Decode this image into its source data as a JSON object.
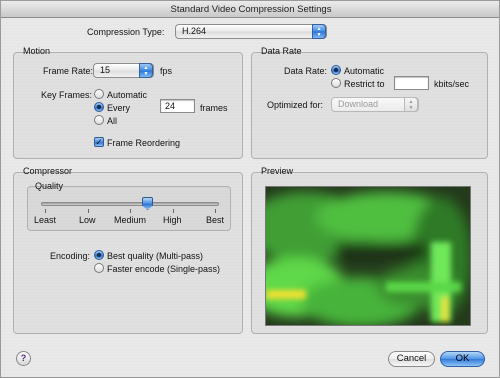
{
  "window": {
    "title": "Standard Video Compression Settings"
  },
  "compression_type": {
    "label": "Compression Type:",
    "value": "H.264"
  },
  "motion": {
    "title": "Motion",
    "frame_rate_label": "Frame Rate:",
    "frame_rate_value": "15",
    "frame_rate_unit": "fps",
    "key_frames_label": "Key Frames:",
    "key_frames_options": [
      "Automatic",
      "Every",
      "All"
    ],
    "key_frames_selected": "Every",
    "key_frames_every_value": "24",
    "key_frames_every_unit": "frames",
    "frame_reordering_label": "Frame Reordering",
    "frame_reordering_checked": true
  },
  "data_rate": {
    "title": "Data Rate",
    "label": "Data Rate:",
    "options": [
      "Automatic",
      "Restrict to"
    ],
    "selected": "Automatic",
    "restrict_value": "",
    "unit": "kbits/sec",
    "optimized_label": "Optimized for:",
    "optimized_value": "Download"
  },
  "compressor": {
    "title": "Compressor",
    "quality_label": "Quality",
    "quality_levels": [
      "Least",
      "Low",
      "Medium",
      "High",
      "Best"
    ],
    "quality_fraction": 0.6,
    "encoding_label": "Encoding:",
    "encoding_options": [
      "Best quality (Multi-pass)",
      "Faster encode (Single-pass)"
    ],
    "encoding_selected": "Best quality (Multi-pass)"
  },
  "preview": {
    "title": "Preview"
  },
  "buttons": {
    "help": "?",
    "cancel": "Cancel",
    "ok": "OK"
  },
  "colors": {
    "accent": "#3f86dc",
    "preview_green": "#5fd84a",
    "preview_highlight": "#f2e030"
  }
}
